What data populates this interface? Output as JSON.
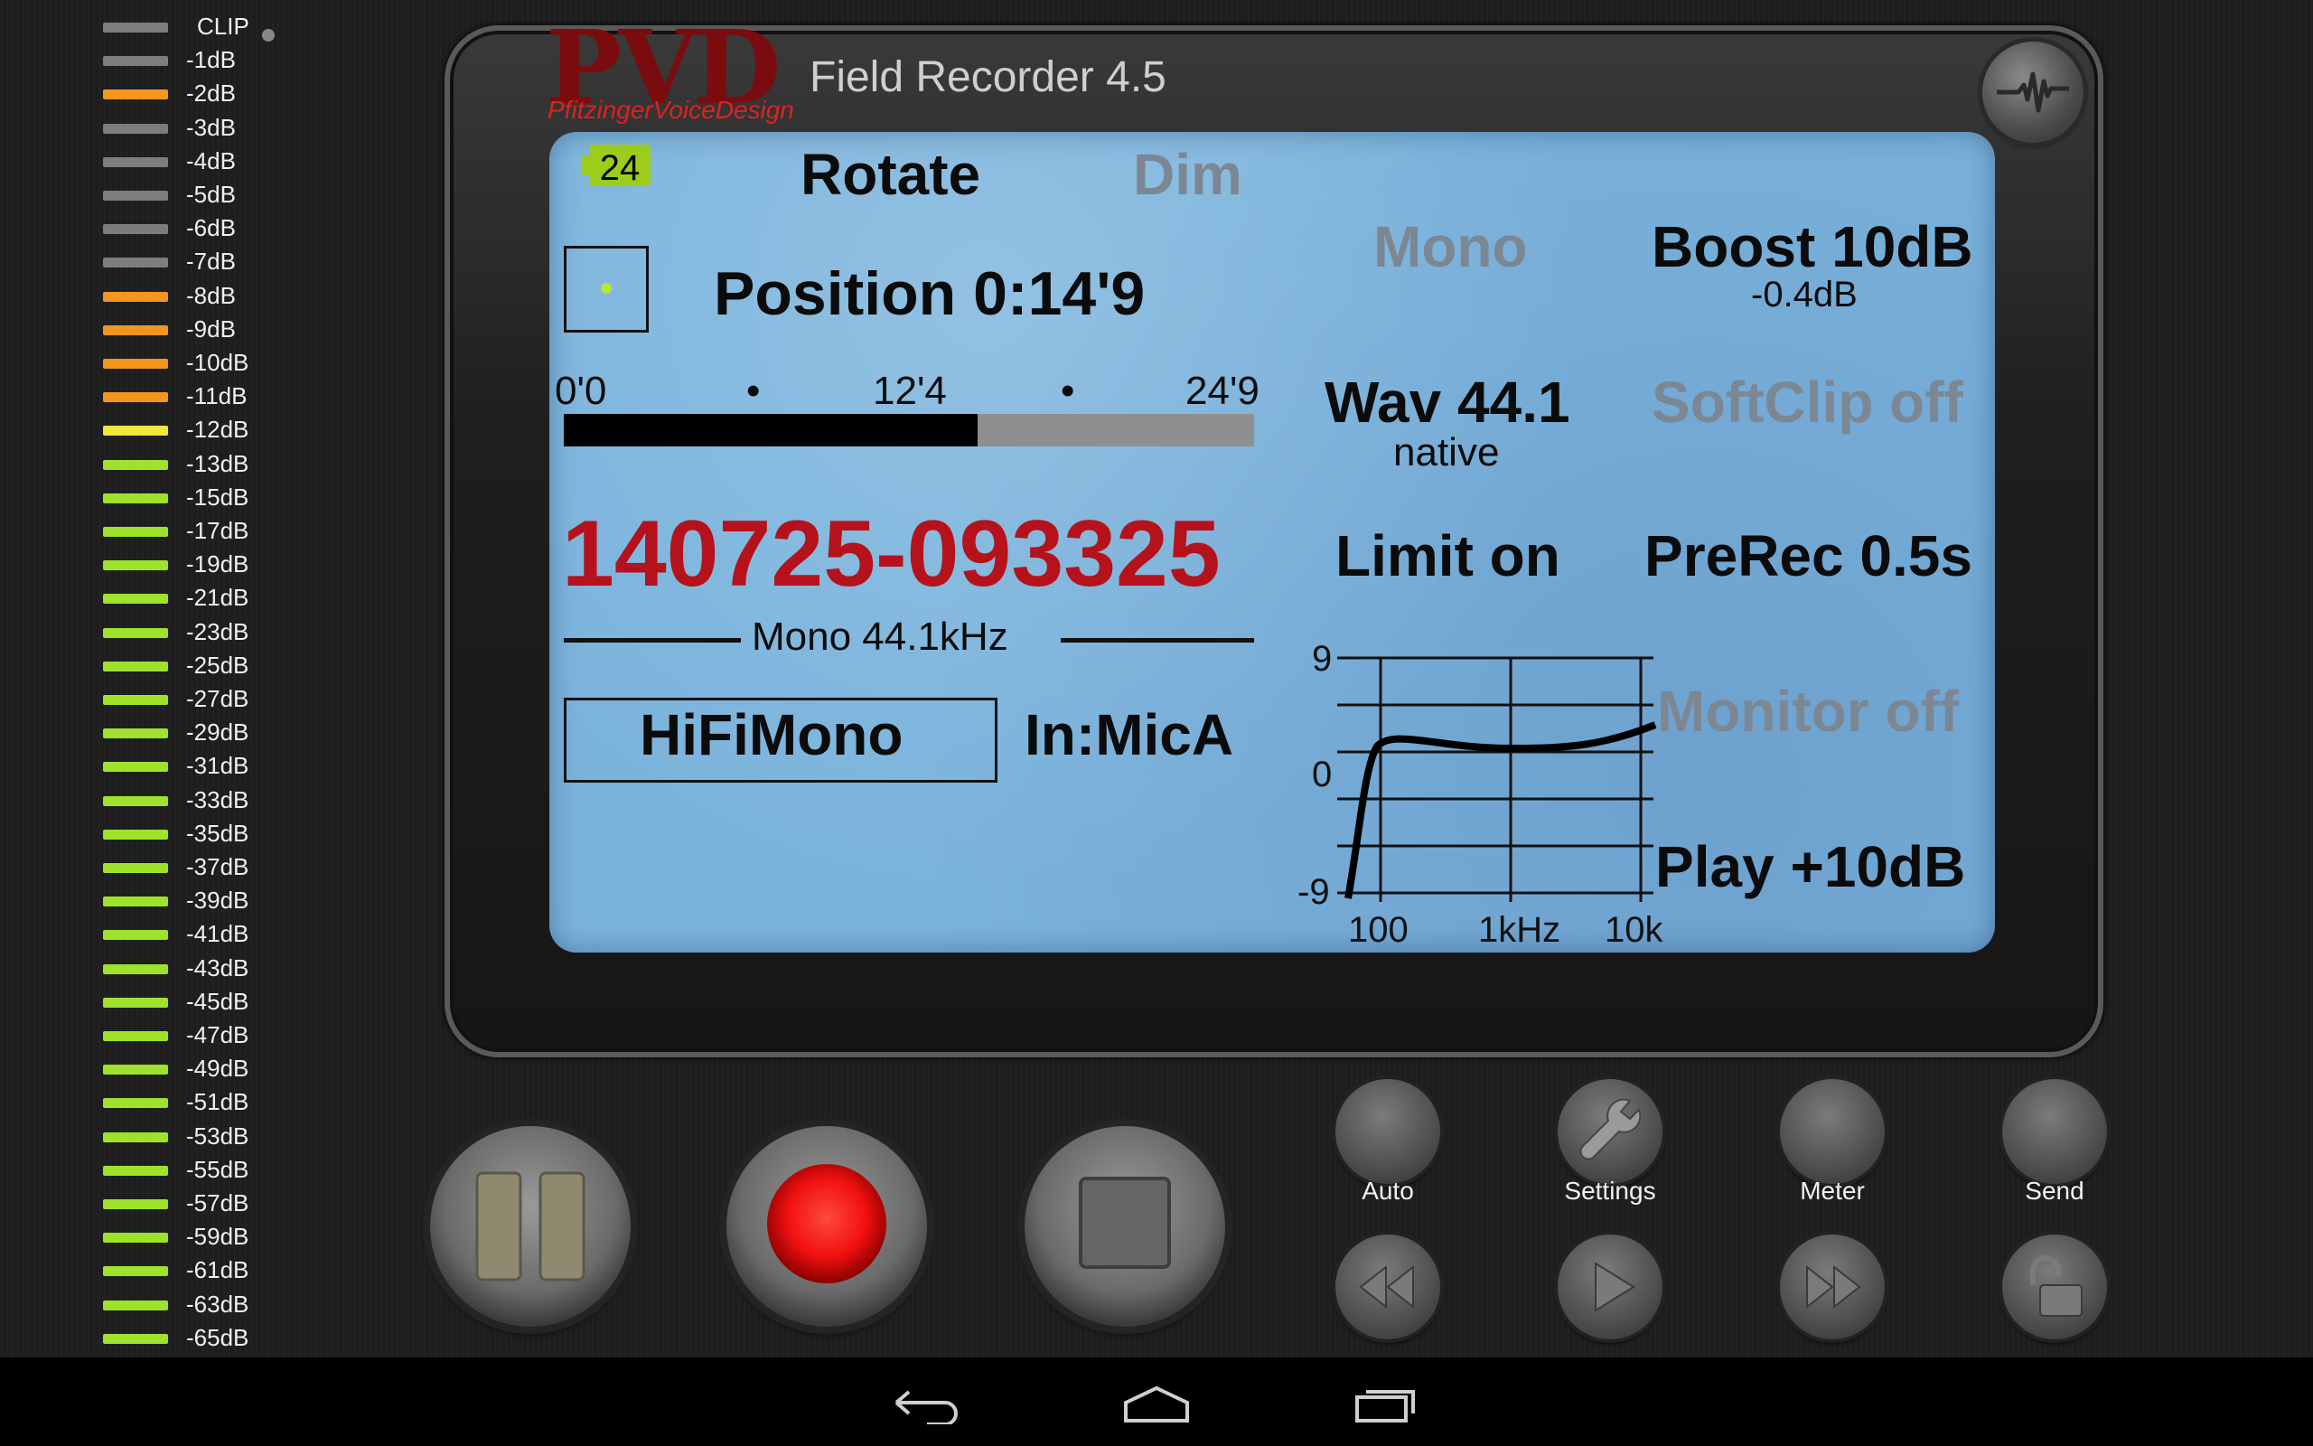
{
  "app": {
    "title": "Field Recorder 4.5",
    "logo_text": "PVD",
    "logo_subtitle": "PfitzingerVoiceDesign"
  },
  "meter": {
    "labels": [
      "CLIP",
      "-1dB",
      "-2dB",
      "-3dB",
      "-4dB",
      "-5dB",
      "-6dB",
      "-7dB",
      "-8dB",
      "-9dB",
      "-10dB",
      "-11dB",
      "-12dB",
      "-13dB",
      "-15dB",
      "-17dB",
      "-19dB",
      "-21dB",
      "-23dB",
      "-25dB",
      "-27dB",
      "-29dB",
      "-31dB",
      "-33dB",
      "-35dB",
      "-37dB",
      "-39dB",
      "-41dB",
      "-43dB",
      "-45dB",
      "-47dB",
      "-49dB",
      "-51dB",
      "-53dB",
      "-55dB",
      "-57dB",
      "-59dB",
      "-61dB",
      "-63dB",
      "-65dB"
    ],
    "colors": [
      "gray",
      "gray",
      "orange",
      "gray",
      "gray",
      "gray",
      "gray",
      "gray",
      "orange",
      "orange",
      "orange",
      "orange",
      "yellow",
      "green",
      "green",
      "green",
      "green",
      "green",
      "green",
      "green",
      "green",
      "green",
      "green",
      "green",
      "green",
      "green",
      "green",
      "green",
      "green",
      "green",
      "green",
      "green",
      "green",
      "green",
      "green",
      "green",
      "green",
      "green",
      "green",
      "green"
    ]
  },
  "palette": {
    "gray": "#7d7d7d",
    "orange": "#f3961d",
    "yellow": "#f1e63a",
    "green": "#9fe22b",
    "accent_red": "#b5121b",
    "lcd_blue": "#7ab3dc"
  },
  "lcd": {
    "battery": "24",
    "rotate": "Rotate",
    "dim": "Dim",
    "position": "Position 0:14'9",
    "timeline": {
      "start": "0'0",
      "mid": "12'4",
      "end": "24'9",
      "progress": 0.6
    },
    "filename": "140725-093325",
    "format_caption": "Mono 44.1kHz",
    "mode": "HiFiMono",
    "input": "In:MicA",
    "mono": "Mono",
    "boost": "Boost 10dB",
    "boost_sub": "-0.4dB",
    "wav": "Wav 44.1",
    "wav_sub": "native",
    "softclip": "SoftClip off",
    "limit": "Limit on",
    "prerec": "PreRec 0.5s",
    "monitor": "Monitor off",
    "play": "Play +10dB"
  },
  "eq_graph": {
    "y_labels": [
      "9",
      "0",
      "-9"
    ],
    "x_labels": [
      "100",
      "1kHz",
      "10k"
    ]
  },
  "buttons": {
    "auto": "Auto",
    "settings": "Settings",
    "meter": "Meter",
    "send": "Send"
  },
  "icons": {
    "wave": "waveform-icon",
    "pause": "pause-icon",
    "record": "record-icon",
    "stop": "stop-icon",
    "settings": "wrench-icon",
    "rewind": "rewind-icon",
    "play": "play-icon",
    "forward": "fast-forward-icon",
    "lock": "unlock-icon",
    "back": "back-icon",
    "home": "home-icon",
    "recents": "recents-icon"
  }
}
